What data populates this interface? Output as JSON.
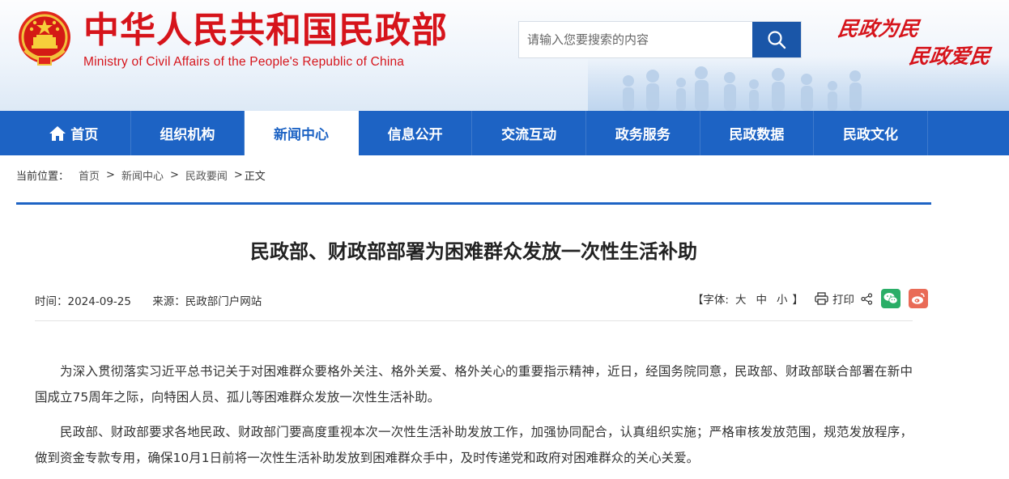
{
  "header": {
    "title_cn": "中华人民共和国民政部",
    "title_en": "Ministry of Civil Affairs of the People's Republic of China",
    "slogan_1": "民政为民",
    "slogan_2": "民政爱民",
    "emblem_icon": "national-emblem-icon",
    "brand_color": "#d6141b"
  },
  "search": {
    "placeholder": "请输入您要搜索的内容",
    "button_icon": "search-icon",
    "button_color": "#1a56a8"
  },
  "nav": {
    "accent": "#1d63c4",
    "items": [
      {
        "label": "首页",
        "icon": "home-icon"
      },
      {
        "label": "组织机构"
      },
      {
        "label": "新闻中心",
        "active": true
      },
      {
        "label": "信息公开"
      },
      {
        "label": "交流互动"
      },
      {
        "label": "政务服务"
      },
      {
        "label": "民政数据"
      },
      {
        "label": "民政文化"
      }
    ]
  },
  "breadcrumb": {
    "prefix": "当前位置：",
    "items": [
      "首页",
      "新闻中心",
      "民政要闻",
      "正文"
    ],
    "separator": ">"
  },
  "article": {
    "title": "民政部、财政部部署为困难群众发放一次性生活补助",
    "time_label": "时间：2024-09-25",
    "source_label": "来源：民政部门户网站",
    "font_size_label": "【字体:",
    "font_size_options": [
      "大",
      "中",
      "小"
    ],
    "font_size_close": "】",
    "print_label": "打印",
    "share_icons": [
      "share-icon",
      "wechat-icon",
      "weibo-icon"
    ],
    "paragraphs": [
      "为深入贯彻落实习近平总书记关于对困难群众要格外关注、格外关爱、格外关心的重要指示精神，近日，经国务院同意，民政部、财政部联合部署在新中国成立75周年之际，向特困人员、孤儿等困难群众发放一次性生活补助。",
      "民政部、财政部要求各地民政、财政部门要高度重视本次一次性生活补助发放工作，加强协同配合，认真组织实施；严格审核发放范围，规范发放程序，做到资金专款专用，确保10月1日前将一次性生活补助发放到困难群众手中，及时传递党和政府对困难群众的关心关爱。"
    ]
  }
}
